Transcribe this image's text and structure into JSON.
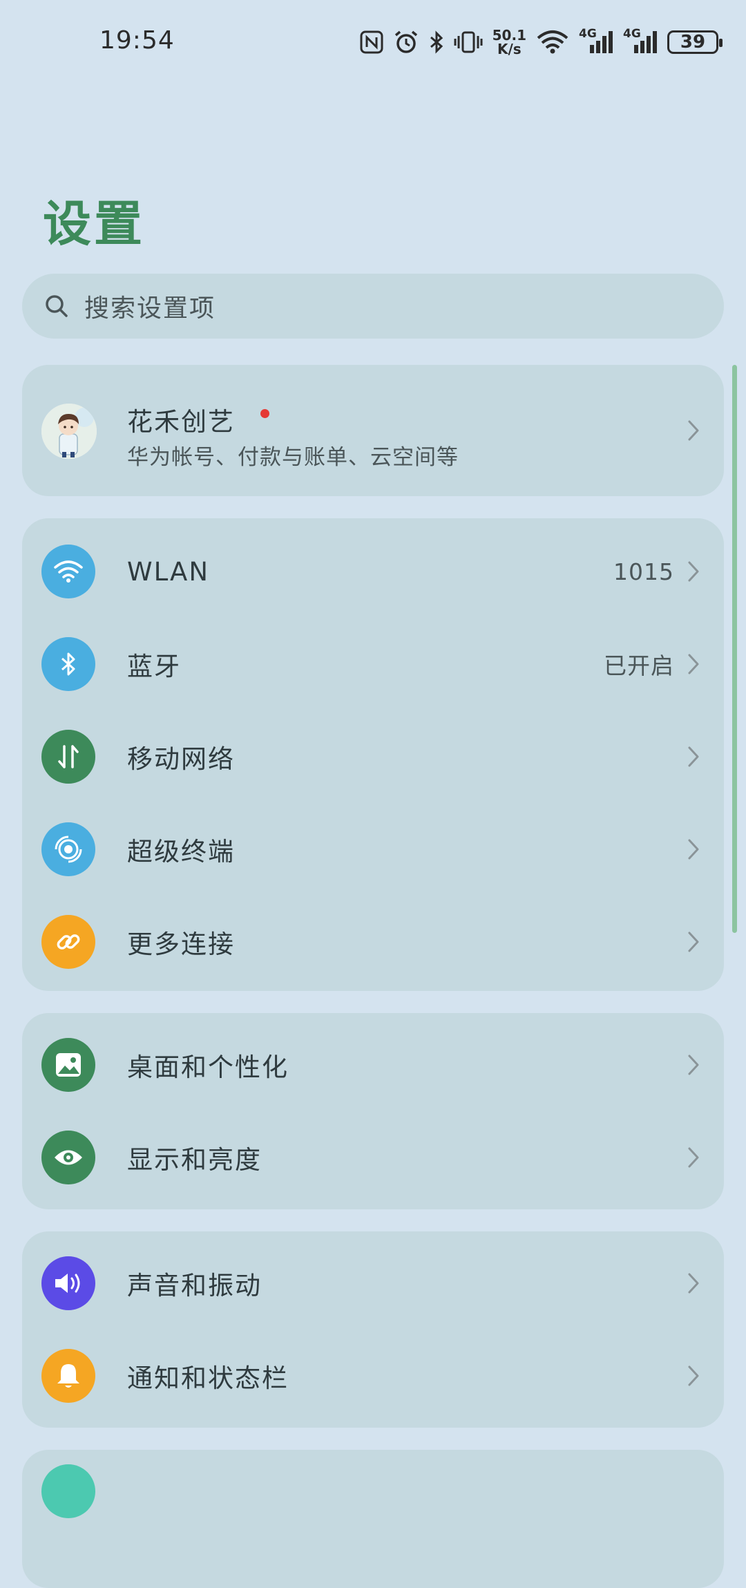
{
  "status_bar": {
    "time": "19:54",
    "net_speed_value": "50.1",
    "net_speed_unit": "K/s",
    "signal1_label": "4G",
    "signal2_label": "4G",
    "battery": "39",
    "icons": [
      "nfc-icon",
      "alarm-icon",
      "bluetooth-icon",
      "vibrate-icon",
      "wifi-icon",
      "signal-icon",
      "battery-icon"
    ]
  },
  "page": {
    "title": "设置"
  },
  "search": {
    "placeholder": "搜索设置项"
  },
  "account": {
    "name": "花禾创艺",
    "subtitle": "华为帐号、付款与账单、云空间等",
    "notification_dot_color": "#e53935"
  },
  "groups": [
    {
      "items": [
        {
          "label": "WLAN",
          "value": "1015",
          "icon": "wifi-icon",
          "color": "#4aaee0"
        },
        {
          "label": "蓝牙",
          "value": "已开启",
          "icon": "bluetooth-icon",
          "color": "#4aaee0"
        },
        {
          "label": "移动网络",
          "value": "",
          "icon": "mobile-data-icon",
          "color": "#3d8a5a"
        },
        {
          "label": "超级终端",
          "value": "",
          "icon": "super-device-icon",
          "color": "#4aaee0"
        },
        {
          "label": "更多连接",
          "value": "",
          "icon": "link-icon",
          "color": "#f5a623"
        }
      ]
    },
    {
      "items": [
        {
          "label": "桌面和个性化",
          "icon": "image-icon",
          "color": "#3d8a5a"
        },
        {
          "label": "显示和亮度",
          "icon": "eye-icon",
          "color": "#3d8a5a"
        }
      ]
    },
    {
      "items": [
        {
          "label": "声音和振动",
          "icon": "speaker-icon",
          "color": "#5b4be6"
        },
        {
          "label": "通知和状态栏",
          "icon": "bell-icon",
          "color": "#f5a623"
        }
      ]
    }
  ],
  "colors": {
    "background": "#d4e3ef",
    "card": "#c5d9e0",
    "title": "#3d8a5a"
  }
}
